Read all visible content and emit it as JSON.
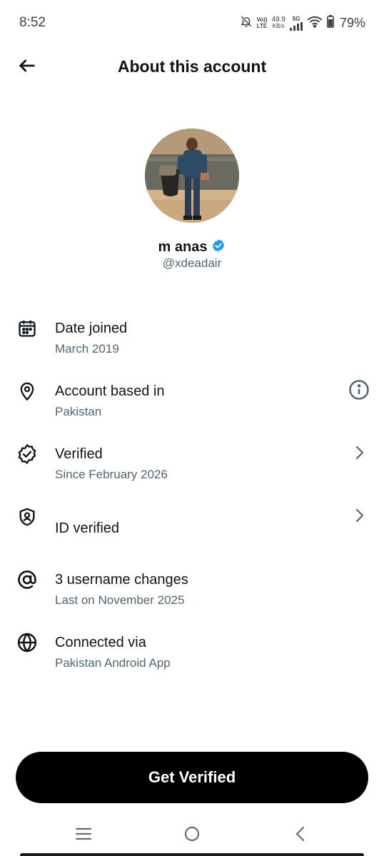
{
  "status_bar": {
    "time": "8:52",
    "volte_top": "Vo))",
    "volte_bottom": "LTE",
    "speed_value": "49.9",
    "speed_unit": "KB/s",
    "network": "5G",
    "battery": "79%"
  },
  "header": {
    "title": "About this account",
    "back_icon": "arrow-left-icon"
  },
  "profile": {
    "name": "m anas",
    "handle": "@xdeadair",
    "verified_badge_color": "#1d9bf0"
  },
  "rows": [
    {
      "icon": "calendar-icon",
      "title": "Date joined",
      "subtitle": "March 2019"
    },
    {
      "icon": "location-pin-icon",
      "title": "Account based in",
      "subtitle": "Pakistan",
      "action_icon": "info-icon"
    },
    {
      "icon": "verified-badge-icon",
      "title": "Verified",
      "subtitle": "Since February 2026",
      "action_icon": "chevron-right-icon"
    },
    {
      "icon": "id-shield-icon",
      "title": "ID verified",
      "action_icon": "chevron-right-icon"
    },
    {
      "icon": "at-sign-icon",
      "title": "3 username changes",
      "subtitle": "Last on November 2025"
    },
    {
      "icon": "globe-icon",
      "title": "Connected via",
      "subtitle": "Pakistan Android App"
    }
  ],
  "cta": {
    "label": "Get Verified"
  },
  "colors": {
    "text_primary": "#0f1419",
    "text_secondary": "#536471",
    "button_bg": "#000000",
    "button_text": "#ffffff"
  }
}
